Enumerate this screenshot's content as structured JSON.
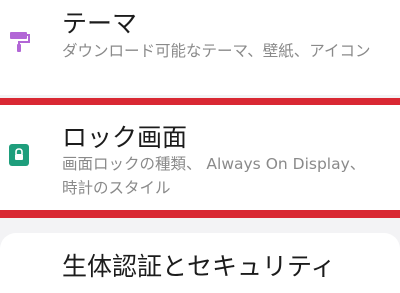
{
  "settings": {
    "items": [
      {
        "title": "テーマ",
        "description": "ダウンロード可能なテーマ、壁紙、アイコン",
        "icon": "paint-roller-icon",
        "color": "#b266d6"
      },
      {
        "title": "ロック画面",
        "description": "画面ロックの種類、 Always On Display、 時計のスタイル",
        "icon": "lock-screen-icon",
        "color": "#1e9e7c"
      },
      {
        "title": "生体認証とセキュリティ"
      }
    ]
  },
  "highlight_color": "#d92833"
}
